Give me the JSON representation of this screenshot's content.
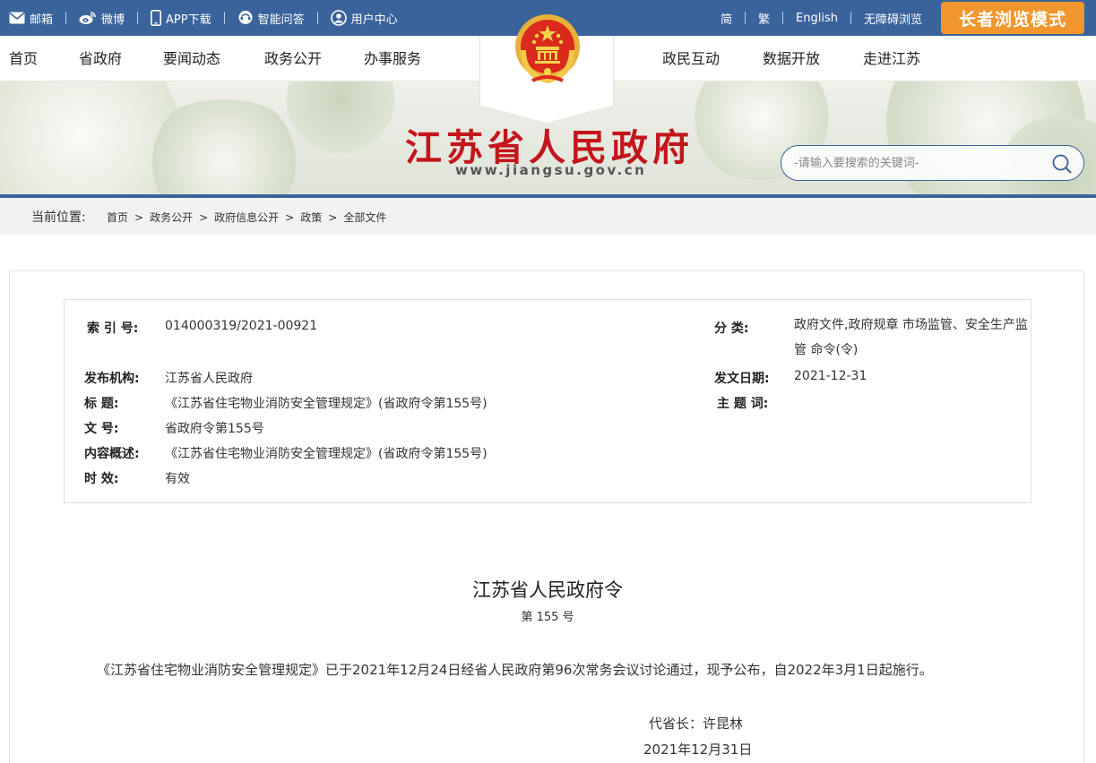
{
  "topbar": {
    "links": [
      {
        "label": "邮箱",
        "icon": "mail-icon"
      },
      {
        "label": "微博",
        "icon": "weibo-icon"
      },
      {
        "label": "APP下载",
        "icon": "phone-icon"
      },
      {
        "label": "智能问答",
        "icon": "chat-icon"
      },
      {
        "label": "用户中心",
        "icon": "user-icon"
      }
    ],
    "lang_simplified": "简",
    "lang_traditional": "繁",
    "lang_english": "English",
    "accessibility": "无障碍浏览",
    "elder_mode": "长者浏览模式"
  },
  "nav": {
    "left": [
      "首页",
      "省政府",
      "要闻动态",
      "政务公开",
      "办事服务"
    ],
    "right": [
      "政民互动",
      "数据开放",
      "走进江苏"
    ]
  },
  "banner": {
    "title": "江苏省人民政府",
    "url": "www.jiangsu.gov.cn",
    "search_placeholder": "-请输入要搜索的关键词-"
  },
  "breadcrumb": {
    "label": "当前位置:",
    "items": [
      "首页",
      "政务公开",
      "政府信息公开",
      "政策",
      "全部文件"
    ],
    "separator": ">"
  },
  "meta": {
    "index_key": "索 引 号:",
    "index_val": "014000319/2021-00921",
    "category_key": "分 类:",
    "category_val": "政府文件,政府规章 市场监管、安全生产监管 命令(令)",
    "publisher_key": "发布机构:",
    "publisher_val": "江苏省人民政府",
    "date_key": "发文日期:",
    "date_val": "2021-12-31",
    "title_key": "标 题:",
    "title_val": "《江苏省住宅物业消防安全管理规定》(省政府令第155号)",
    "subject_key": "主 题 词:",
    "subject_val": "",
    "docno_key": "文 号:",
    "docno_val": "省政府令第155号",
    "summary_key": "内容概述:",
    "summary_val": "《江苏省住宅物业消防安全管理规定》(省政府令第155号)",
    "validity_key": "时 效:",
    "validity_val": "有效"
  },
  "document": {
    "title": "江苏省人民政府令",
    "number": "第 155 号",
    "body": "《江苏省住宅物业消防安全管理规定》已于2021年12月24日经省人民政府第96次常务会议讨论通过，现予公布，自2022年3月1日起施行。",
    "signer": "代省长：许昆林",
    "date": "2021年12月31日"
  },
  "colors": {
    "top_bar": "#3a639c",
    "elder_button": "#f0962c",
    "title_red": "#c3161c"
  }
}
